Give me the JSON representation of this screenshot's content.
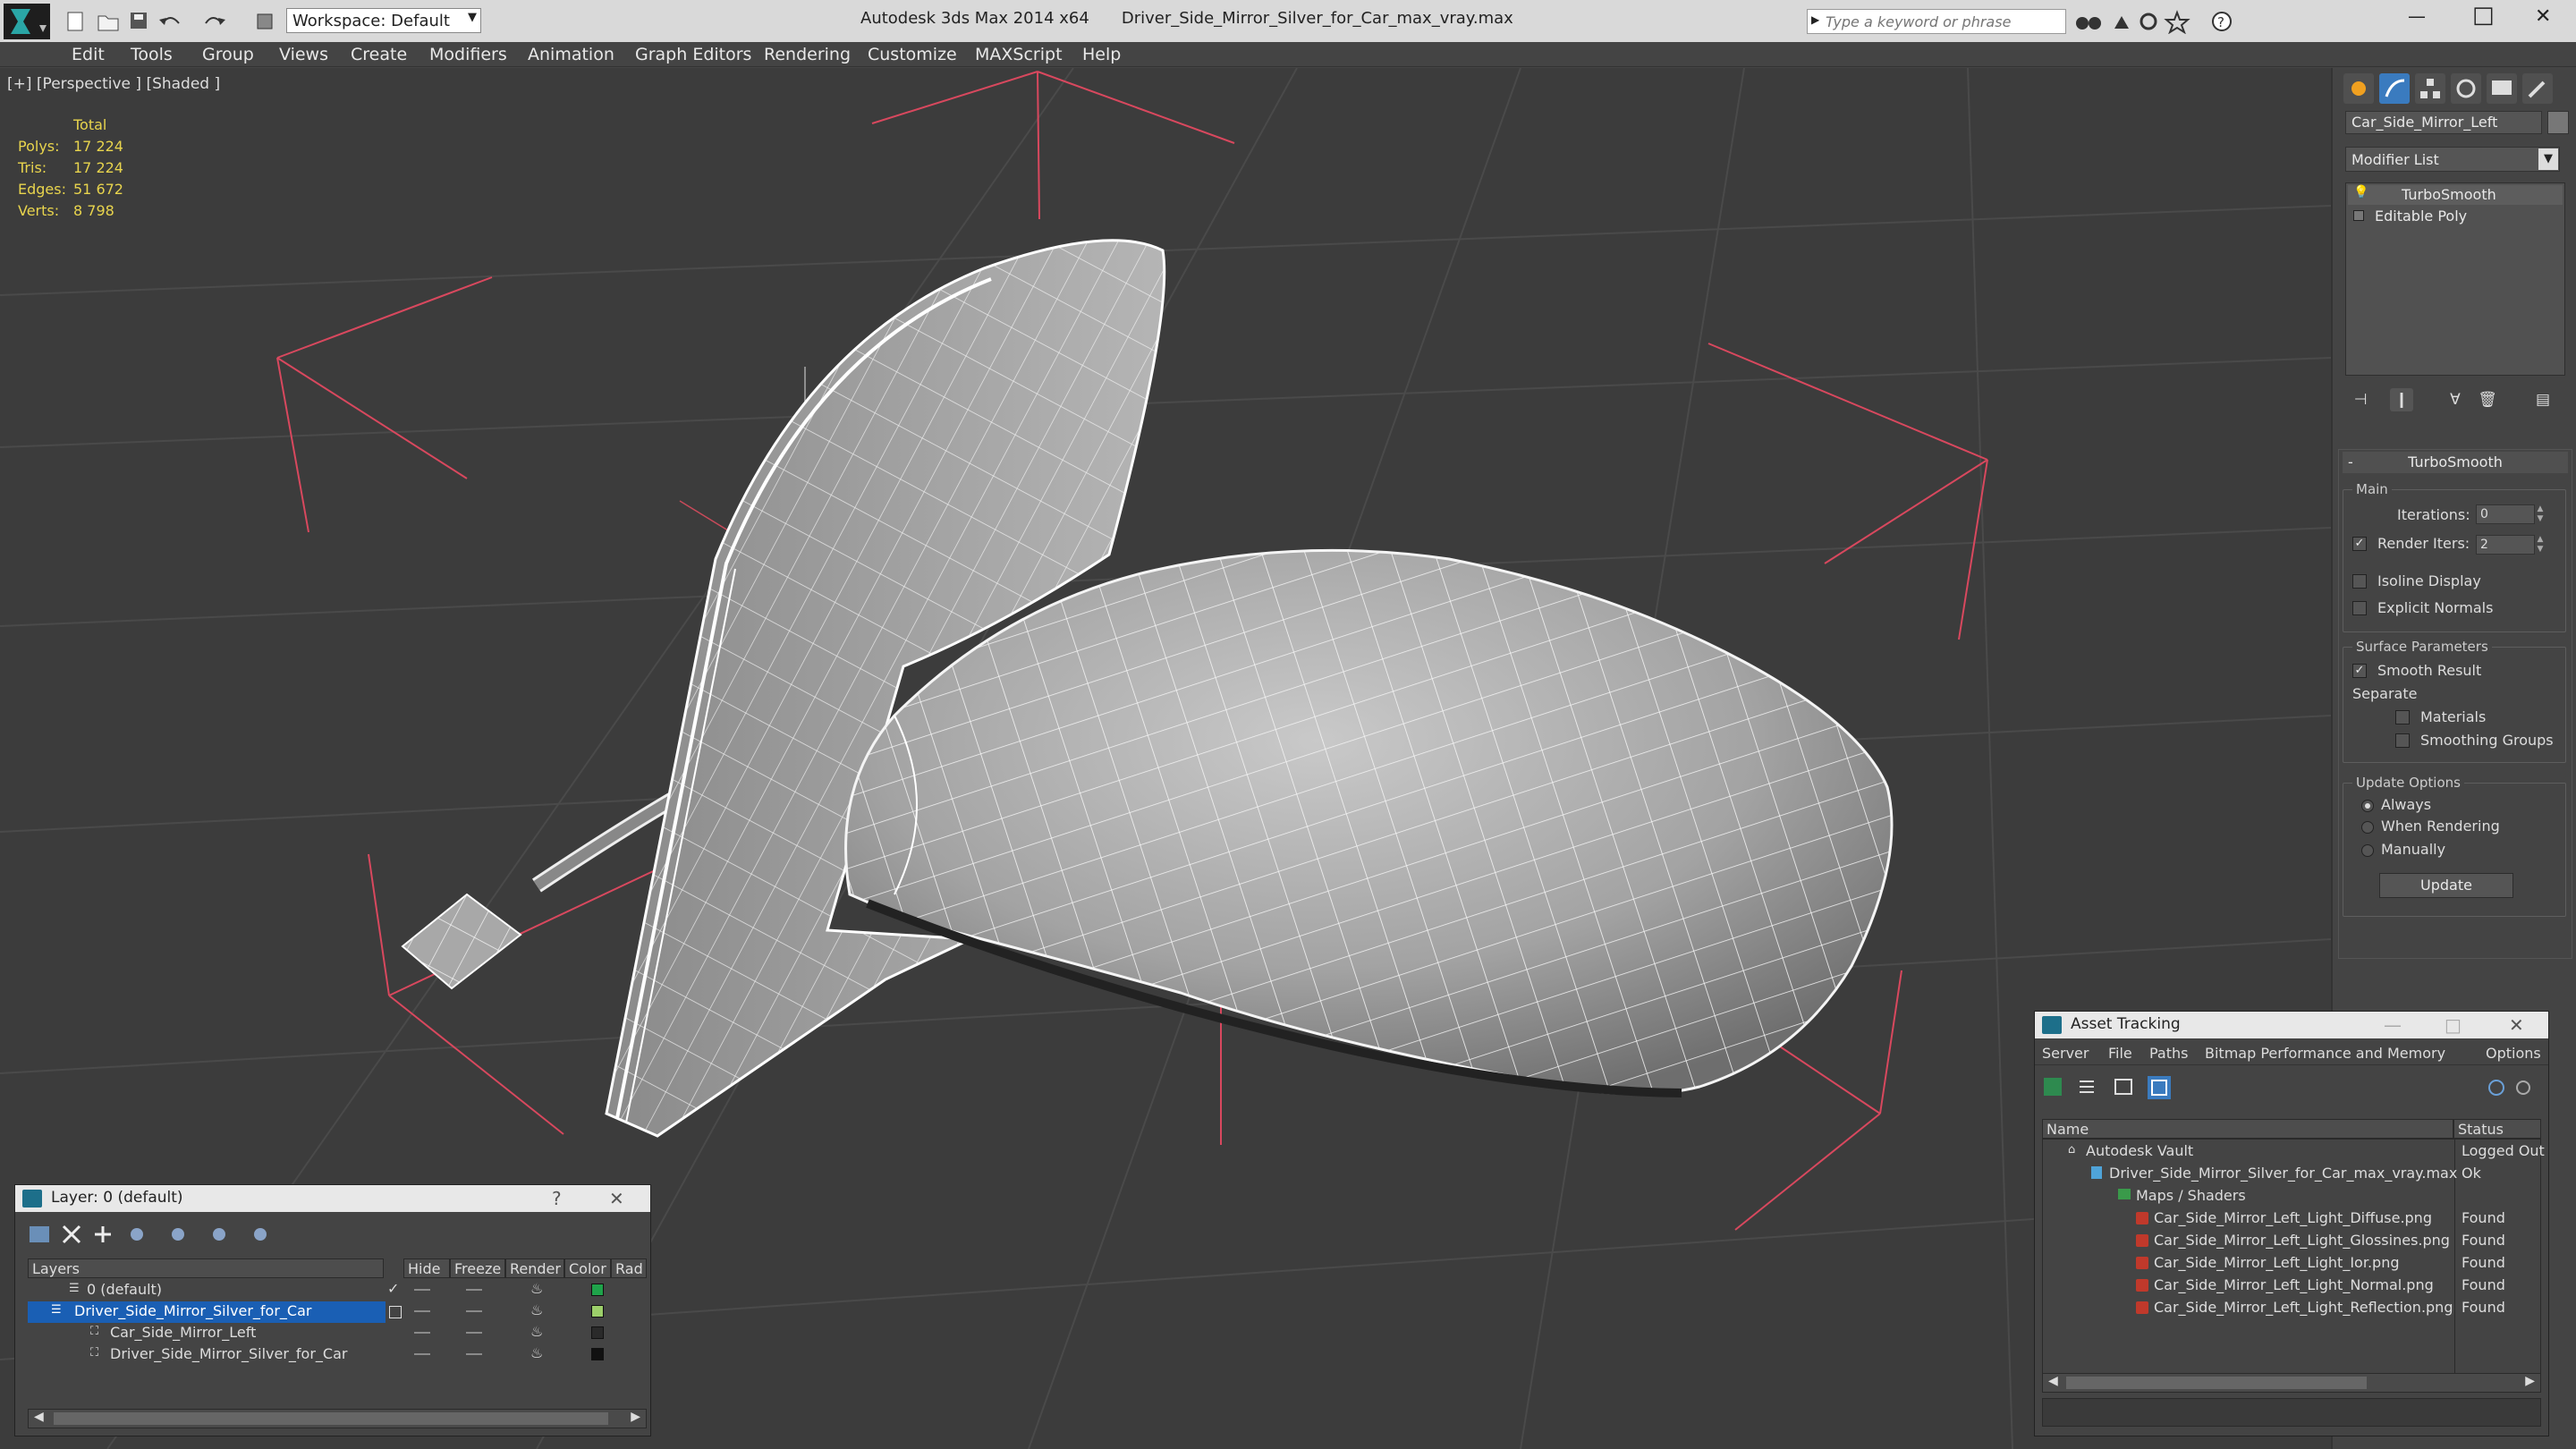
{
  "titlebar": {
    "app_title": "Autodesk 3ds Max 2014 x64",
    "file_title": "Driver_Side_Mirror_Silver_for_Car_max_vray.max",
    "workspace": "Workspace: Default",
    "search_placeholder": "Type a keyword or phrase",
    "minimize": "—",
    "maximize": "□",
    "close": "✕"
  },
  "menu": [
    "Edit",
    "Tools",
    "Group",
    "Views",
    "Create",
    "Modifiers",
    "Animation",
    "Graph Editors",
    "Rendering",
    "Customize",
    "MAXScript",
    "Help"
  ],
  "viewport": {
    "label": "[+] [Perspective ] [Shaded ]",
    "stats": {
      "header": "Total",
      "rows": [
        {
          "key": "Polys:",
          "value": "17 224"
        },
        {
          "key": "Tris:",
          "value": "17 224"
        },
        {
          "key": "Edges:",
          "value": "51 672"
        },
        {
          "key": "Verts:",
          "value": "8 798"
        }
      ]
    }
  },
  "command_panel": {
    "object_name": "Car_Side_Mirror_Left",
    "modifier_list": "Modifier List",
    "stack": [
      "TurboSmooth",
      "Editable Poly"
    ],
    "rollout_title": "TurboSmooth",
    "main_group": "Main",
    "iterations_label": "Iterations:",
    "iterations_value": "0",
    "render_iters_label": "Render Iters:",
    "render_iters_value": "2",
    "render_iters_checked": true,
    "isoline_label": "Isoline Display",
    "explicit_normals_label": "Explicit Normals",
    "surface_group": "Surface Parameters",
    "smooth_result_label": "Smooth Result",
    "separate_label": "Separate",
    "materials_label": "Materials",
    "smoothing_groups_label": "Smoothing Groups",
    "update_group": "Update Options",
    "update_options": [
      "Always",
      "When Rendering",
      "Manually"
    ],
    "update_selected": 0,
    "update_button": "Update"
  },
  "layer_window": {
    "title": "Layer: 0 (default)",
    "help": "?",
    "close": "✕",
    "columns": [
      "Layers",
      "Hide",
      "Freeze",
      "Render",
      "Color",
      "Rad"
    ],
    "rows": [
      {
        "name": "0 (default)",
        "indent": 1,
        "color": "#1fa34a",
        "selected": false,
        "current": true
      },
      {
        "name": "Driver_Side_Mirror_Silver_for_Car",
        "indent": 1,
        "color": "#9ccf6a",
        "selected": true,
        "current": false
      },
      {
        "name": "Car_Side_Mirror_Left",
        "indent": 2,
        "color": "#2a2a2a",
        "selected": false,
        "current": false
      },
      {
        "name": "Driver_Side_Mirror_Silver_for_Car",
        "indent": 2,
        "color": "#111111",
        "selected": false,
        "current": false
      }
    ]
  },
  "asset_window": {
    "title": "Asset Tracking",
    "menu": [
      "Server",
      "File",
      "Paths",
      "Bitmap Performance and Memory",
      "Options"
    ],
    "columns": [
      "Name",
      "Status"
    ],
    "rows": [
      {
        "name": "Autodesk Vault",
        "status": "Logged Out",
        "indent": 1,
        "icon": "vault-icon"
      },
      {
        "name": "Driver_Side_Mirror_Silver_for_Car_max_vray.max",
        "status": "Ok",
        "indent": 2,
        "icon": "max-file-icon"
      },
      {
        "name": "Maps / Shaders",
        "status": "",
        "indent": 3,
        "icon": "folder-icon"
      },
      {
        "name": "Car_Side_Mirror_Left_Light_Diffuse.png",
        "status": "Found",
        "indent": 4,
        "icon": "png-icon"
      },
      {
        "name": "Car_Side_Mirror_Left_Light_Glossines.png",
        "status": "Found",
        "indent": 4,
        "icon": "png-icon"
      },
      {
        "name": "Car_Side_Mirror_Left_Light_Ior.png",
        "status": "Found",
        "indent": 4,
        "icon": "png-icon"
      },
      {
        "name": "Car_Side_Mirror_Left_Light_Normal.png",
        "status": "Found",
        "indent": 4,
        "icon": "png-icon"
      },
      {
        "name": "Car_Side_Mirror_Left_Light_Reflection.png",
        "status": "Found",
        "indent": 4,
        "icon": "png-icon"
      }
    ]
  },
  "colors": {
    "stats_text": "#e8d44d",
    "selection": "#1a5fb4",
    "gizmo": "#d8485e",
    "viewport_bg": "#3c3c3c"
  }
}
